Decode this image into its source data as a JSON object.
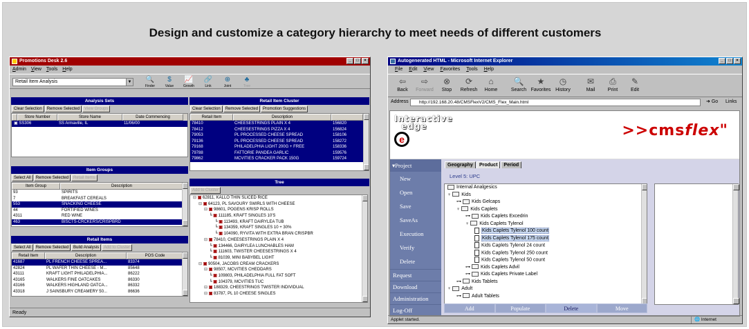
{
  "headline": "Design and customize a category hierarchy to meet needs of different customers",
  "promo": {
    "title": "Promotions Desk 2.6",
    "menu": [
      "Admin",
      "View",
      "Tools",
      "Help"
    ],
    "combo_value": "Retail Item Analysis",
    "tools": [
      "Finder",
      "Value",
      "Growth",
      "Link",
      "Joint",
      "Tree"
    ],
    "analysis_sets": {
      "heading": "Analysis Sets",
      "buttons": [
        "Clear Selection",
        "Remove Selected",
        "View Groups"
      ],
      "columns": [
        "Store Number",
        "Store Name",
        "Date Commencing"
      ],
      "rows": [
        [
          "SS306",
          "SS Armaville, IL",
          "11/06/00"
        ]
      ]
    },
    "item_groups": {
      "heading": "Item Groups",
      "buttons": [
        "Select All",
        "Remove Selected",
        "Retail Items"
      ],
      "columns": [
        "Item Group",
        "Description"
      ],
      "rows": [
        [
          "93",
          "SPIRITS",
          false
        ],
        [
          "7",
          "BREAKFAST CEREALS",
          false
        ],
        [
          "553",
          "SNACKING CHEESE",
          true
        ],
        [
          "44",
          "FORTIFIED WINES",
          false
        ],
        [
          "4311",
          "RED WINE",
          false
        ],
        [
          "463",
          "BISCTS-CRCKERS/CRISPBRD",
          true
        ]
      ]
    },
    "retail_items": {
      "heading": "Retail Items",
      "buttons": [
        "Select All",
        "Remove Selected",
        "Build Analysis",
        "Add to Cluster"
      ],
      "columns": [
        "Retail Item",
        "Description",
        "POS Code"
      ],
      "rows": [
        [
          "41687",
          "PL FRENCH CHEESE SPREA...",
          "83374",
          true
        ],
        [
          "42824",
          "PL WAFER THIN CHEESE - M...",
          "85648",
          false
        ],
        [
          "43111",
          "KRAFT LIGHT PHILADELPHIA...",
          "86222",
          false
        ],
        [
          "43165",
          "WALKERS FINE OATCAKES",
          "86330",
          false
        ],
        [
          "43166",
          "WALKERS HIGHLAND OATCA...",
          "86332",
          false
        ],
        [
          "43318",
          "J SAINSBURY CREAMERY 50...",
          "86636",
          false
        ]
      ]
    },
    "cluster": {
      "heading": "Retail Item Cluster",
      "buttons": [
        "Clear Selection",
        "Remove Selected",
        "Promotion Suggestions"
      ],
      "columns": [
        "Retail Item",
        "Description"
      ],
      "rows": [
        [
          "78410",
          "CHEESESTRINGS PLAIN X 4",
          "156820"
        ],
        [
          "78412",
          "CHEESESTRINGS PIZZA X 4",
          "156824"
        ],
        [
          "79053",
          "PL PROCESSED CHEESE SPREAD",
          "158106"
        ],
        [
          "79136",
          "PL PROCESSED CHEESE SPREAD",
          "158272"
        ],
        [
          "79168",
          "PHILADELPHIA LIGHT 200G + FREE",
          "158336"
        ],
        [
          "79788",
          "FATTORIE PANDEA GARLIC",
          "159576"
        ],
        [
          "79862",
          "MCVITIES CRACKER PACK 150G",
          "159724"
        ]
      ]
    },
    "tree": {
      "heading": "Tree",
      "button": "Add to Cluster",
      "lines": [
        "62811, KALLO THIN SLICED RICE",
        "64123, PL SAVOURY SWIRLS WITH CHEESE",
        "98601, POGENS KRISP ROLLS",
        "111185, KRAFT SINGLES 10'S",
        "113493, KRAFT DAIRYLEA TUB",
        "134359, KRAFT SINGLES 10 + 30%",
        "104090, RYVITA WITH EXTRA BRAN CRISPBR",
        "78410, CHEESESTRINGS PLAIN X 4",
        "134466, DAIRYLEA LUNCHABLES HAM",
        "111603, TWISTER CHEESESTRINGS X 4",
        "81039, MINI BABYBEL LIGHT",
        "90504, JACOBS CREAM CRACKERS",
        "98507, MCVITIES CHEDDARS",
        "109803, PHILADELPHIA FULL FAT SOFT",
        "104379, MCVITIES TUC",
        "188329, CHEESTRINGS TWISTER INDIVIDUAL",
        "83787, PL 10 CHEESE SINGLES"
      ]
    },
    "status": "Ready"
  },
  "ie": {
    "title": "Autogenerated HTML - Microsoft Internet Explorer",
    "menu": [
      "File",
      "Edit",
      "View",
      "Favorites",
      "Tools",
      "Help"
    ],
    "toolbar": [
      "Back",
      "Forward",
      "Stop",
      "Refresh",
      "Home",
      "Search",
      "Favorites",
      "History",
      "Mail",
      "Print",
      "Edit"
    ],
    "address_label": "Address",
    "address": "http://192.168.20.48/CMSFlexV2/CMS_Flex_Main.html",
    "go": "Go",
    "links": "Links",
    "logo_interactive": "Interactive",
    "logo_edge": "edge",
    "brand_prefix": ">>cms",
    "brand_suffix": "flex",
    "nav_head": "Project",
    "nav": [
      "New",
      "Open",
      "Save",
      "SaveAs",
      "Execution",
      "Verify",
      "Delete"
    ],
    "nav_bottom": [
      "Request",
      "Download",
      "Administration",
      "Log-Off"
    ],
    "tabs": [
      "Geography",
      "Product",
      "Period"
    ],
    "level": "Level 5: UPC",
    "tree": [
      {
        "indent": 0,
        "kind": "folder",
        "text": "Internal Analgesics"
      },
      {
        "indent": 0,
        "kind": "folder",
        "text": "Kids"
      },
      {
        "indent": 1,
        "kind": "folder",
        "text": "Kids Gelcaps"
      },
      {
        "indent": 1,
        "kind": "folder",
        "text": "Kids Caplets"
      },
      {
        "indent": 2,
        "kind": "folder",
        "text": "Kids Caplets Excedrin"
      },
      {
        "indent": 2,
        "kind": "folder",
        "text": "Kids Caplets Tylenol"
      },
      {
        "indent": 3,
        "kind": "doc",
        "text": "Kids Caplets Tylenol 100 count",
        "hl": true
      },
      {
        "indent": 3,
        "kind": "doc",
        "text": "Kids Caplets Tylenol 175 count",
        "hl": true
      },
      {
        "indent": 3,
        "kind": "doc",
        "text": "Kids Caplets Tylenol 24 count"
      },
      {
        "indent": 3,
        "kind": "doc",
        "text": "Kids Caplets Tylenol 250 count"
      },
      {
        "indent": 3,
        "kind": "doc",
        "text": "Kids Caplets Tylenol 50 count"
      },
      {
        "indent": 2,
        "kind": "folder",
        "text": "Kids Caplets Advil"
      },
      {
        "indent": 2,
        "kind": "folder",
        "text": "Kids Caplets Private Label"
      },
      {
        "indent": 1,
        "kind": "folder",
        "text": "Kids Tablets"
      },
      {
        "indent": 0,
        "kind": "folder",
        "text": "Adult"
      },
      {
        "indent": 1,
        "kind": "folder",
        "text": "Adult Tablets"
      }
    ],
    "actions": [
      "Add",
      "Populate",
      "Delete",
      "Move"
    ],
    "status": "Applet started.",
    "zone": "Internet"
  }
}
